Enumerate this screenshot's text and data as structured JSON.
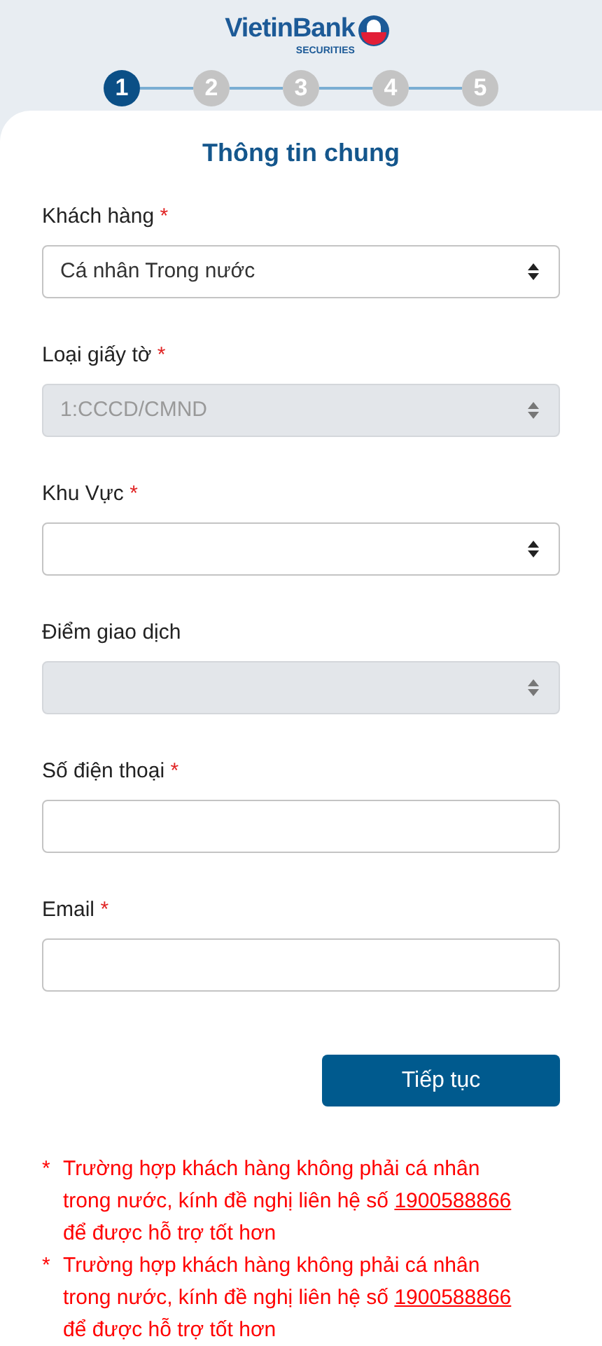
{
  "logo": {
    "name": "VietinBank",
    "subtitle": "SECURITIES"
  },
  "steps": [
    {
      "label": "1",
      "selected": true
    },
    {
      "label": "2",
      "selected": false
    },
    {
      "label": "3",
      "selected": false
    },
    {
      "label": "4",
      "selected": false
    },
    {
      "label": "5",
      "selected": false
    }
  ],
  "title": "Thông tin chung",
  "fields": [
    {
      "label": "Khách hàng",
      "required": true,
      "kind": "select",
      "value": "Cá nhân Trong nước",
      "disabled": false
    },
    {
      "label": "Loại giấy tờ",
      "required": true,
      "kind": "select",
      "value": "1:CCCD/CMND",
      "disabled": true
    },
    {
      "label": "Khu Vực",
      "required": true,
      "kind": "select",
      "disabled": false
    },
    {
      "label": "Điểm giao dịch",
      "required": false,
      "kind": "select",
      "disabled": true
    },
    {
      "label": "Số điện thoại",
      "required": true,
      "kind": "input",
      "disabled": false
    },
    {
      "label": "Email",
      "required": true,
      "kind": "input",
      "disabled": false
    }
  ],
  "required_mark": "*",
  "submit": "Tiếp tục",
  "notes": [
    {
      "mark": "*",
      "text": "Trường hợp khách hàng không phải cá nhân trong nước, kính đề nghị liên hệ số",
      "phone": "1900588866",
      "tail": "để được hỗ trợ tốt hơn"
    },
    {
      "mark": "*",
      "text": "Trường hợp khách hàng không phải cá nhân trong nước, kính đề nghị liên hệ số",
      "phone": "1900588866",
      "tail": "để được hỗ trợ tốt hơn"
    }
  ]
}
